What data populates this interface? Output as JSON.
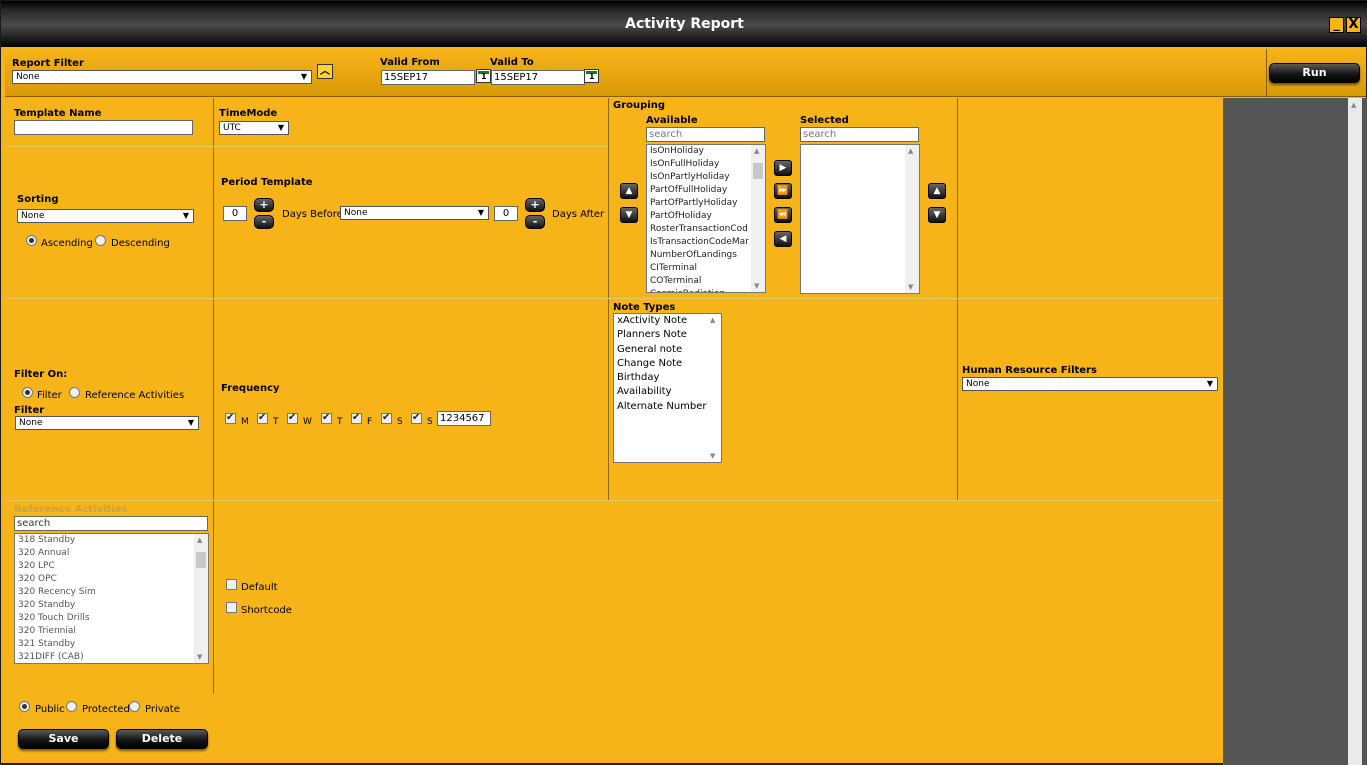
{
  "window": {
    "title": "Activity Report",
    "minimize": "_",
    "close": "X"
  },
  "report_filter": {
    "label": "Report Filter",
    "value": "None"
  },
  "valid_from": {
    "label": "Valid From",
    "value": "15SEP17"
  },
  "valid_to": {
    "label": "Valid To",
    "value": "15SEP17"
  },
  "run_button": "Run",
  "template_name": {
    "label": "Template Name",
    "value": ""
  },
  "timemode": {
    "label": "TimeMode",
    "value": "UTC"
  },
  "sorting": {
    "label": "Sorting",
    "value": "None",
    "ascending": "Ascending",
    "descending": "Descending"
  },
  "period_template": {
    "label": "Period Template",
    "days_before_value": "0",
    "days_before_label": "Days Before",
    "template_value": "None",
    "days_after_value": "0",
    "days_after_label": "Days After",
    "plus": "+",
    "minus": "-"
  },
  "grouping": {
    "label": "Grouping",
    "available_label": "Available",
    "selected_label": "Selected",
    "available_search_placeholder": "search",
    "selected_search_placeholder": "search",
    "available_items": [
      "IsOnHoliday",
      "IsOnFullHoliday",
      "IsOnPartlyHoliday",
      "PartOfFullHoliday",
      "PartOfPartlyHoliday",
      "PartOfHoliday",
      "RosterTransactionCod",
      "IsTransactionCodeMar",
      "NumberOfLandings",
      "CITerminal",
      "COTerminal",
      "CosmicRadiation"
    ]
  },
  "note_types": {
    "label": "Note Types",
    "items": [
      "xActivity Note",
      "Planners Note",
      "General note",
      "Change Note",
      "Birthday",
      "Availability",
      "Alternate Number"
    ]
  },
  "filter_on": {
    "label": "Filter On:",
    "filter_option": "Filter",
    "reference_option": "Reference Activities",
    "filter_label": "Filter",
    "filter_value": "None"
  },
  "frequency": {
    "label": "Frequency",
    "days": [
      "M",
      "T",
      "W",
      "T",
      "F",
      "S",
      "S"
    ],
    "value": "1234567"
  },
  "hr_filters": {
    "label": "Human Resource Filters",
    "value": "None"
  },
  "reference_activities": {
    "label": "Reference Activities",
    "search_placeholder": "search",
    "items": [
      "318 Standby",
      "320 Annual",
      "320 LPC",
      "320 OPC",
      "320 Recency Sim",
      "320 Standby",
      "320 Touch Drills",
      "320 Triennial",
      "321 Standby",
      "321DIFF (CAB)"
    ]
  },
  "default_label": "Default",
  "shortcode_label": "Shortcode",
  "visibility": {
    "public": "Public",
    "protected": "Protected",
    "private": "Private"
  },
  "save_button": "Save",
  "delete_button": "Delete"
}
